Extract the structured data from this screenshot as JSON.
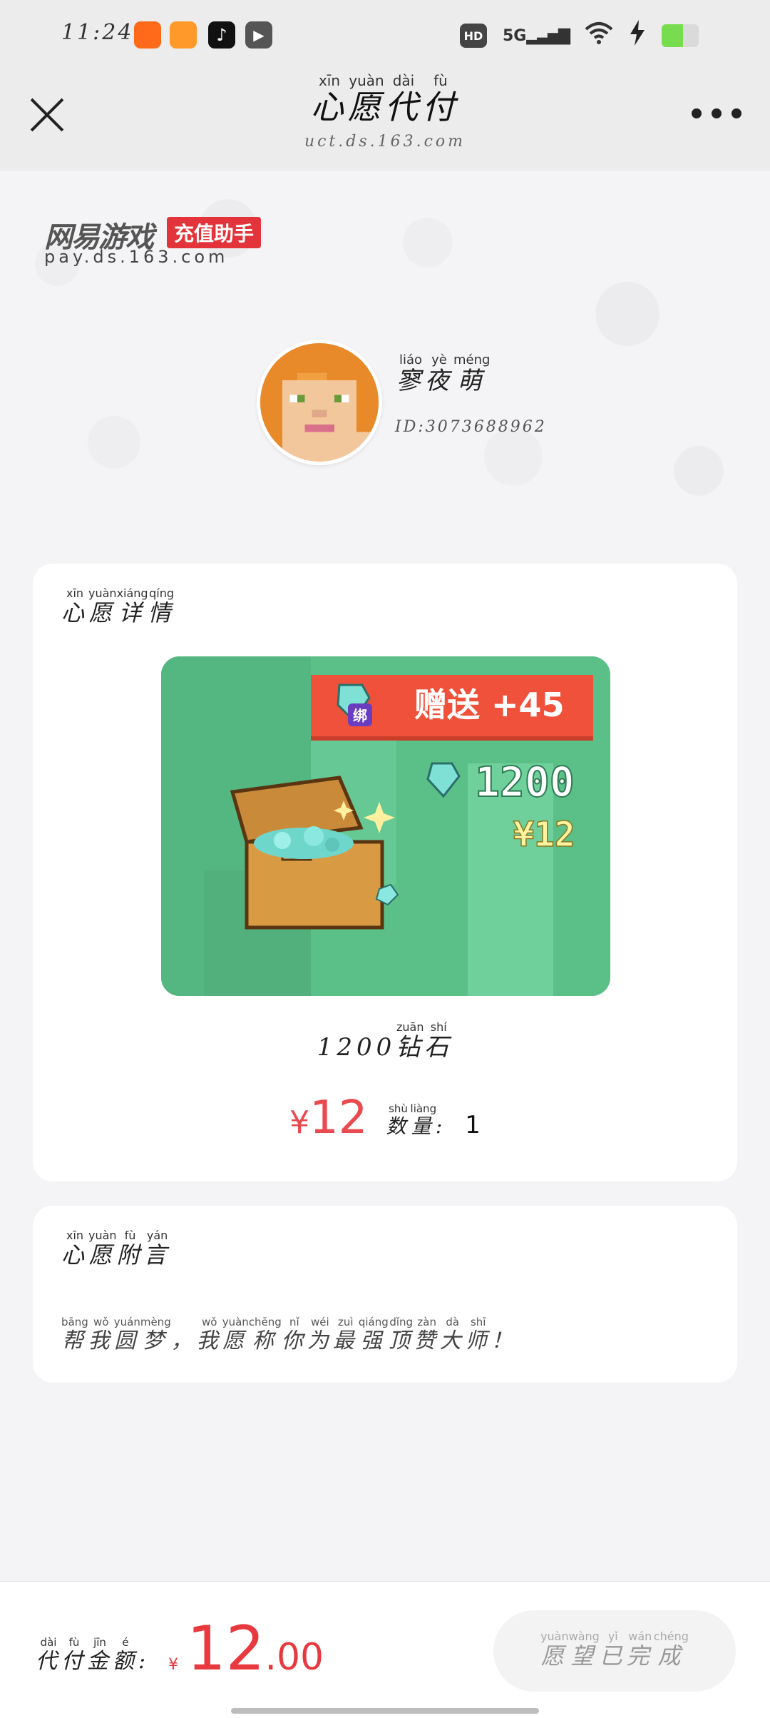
{
  "status_bar": {
    "time": "11:24",
    "network": "5G",
    "hd_label": "HD",
    "apps": [
      {
        "name": "kuaishou-app-icon",
        "color": "#ff6a1a"
      },
      {
        "name": "video-app-icon",
        "color": "#ff9a2a"
      },
      {
        "name": "tiktok-app-icon",
        "color": "#111111"
      },
      {
        "name": "player-app-icon",
        "color": "#555555"
      }
    ]
  },
  "header": {
    "title": [
      {
        "char": "心",
        "py": "xīn"
      },
      {
        "char": "愿",
        "py": "yuàn"
      },
      {
        "char": "代",
        "py": "dài"
      },
      {
        "char": "付",
        "py": "fù"
      }
    ],
    "url": "uct.ds.163.com"
  },
  "brand": {
    "name": "网易游戏",
    "tag": "充值助手",
    "domain": "pay.ds.163.com"
  },
  "user": {
    "name": [
      {
        "char": "寥",
        "py": "liáo"
      },
      {
        "char": "夜",
        "py": "yè"
      },
      {
        "char": "萌",
        "py": "méng"
      }
    ],
    "id": "ID:3073688962"
  },
  "wish_details": {
    "heading": [
      {
        "char": "心",
        "py": "xīn"
      },
      {
        "char": "愿",
        "py": "yuàn"
      },
      {
        "char": "详",
        "py": "xiáng"
      },
      {
        "char": "情",
        "py": "qíng"
      }
    ],
    "product_image": {
      "bonus_badge": "绑",
      "bonus_text": "赠送 +45",
      "amount": "1200",
      "price_tag": "¥12"
    },
    "product_prefix": "1200",
    "product_name": [
      {
        "char": "钻",
        "py": "zuān"
      },
      {
        "char": "石",
        "py": "shí"
      }
    ],
    "price_symbol": "¥",
    "price_value": "12",
    "qty_label": [
      {
        "char": "数",
        "py": "shù"
      },
      {
        "char": "量",
        "py": "liàng"
      }
    ],
    "qty_colon": ":",
    "qty_value": "1"
  },
  "wish_message": {
    "heading": [
      {
        "char": "心",
        "py": "xīn"
      },
      {
        "char": "愿",
        "py": "yuàn"
      },
      {
        "char": "附",
        "py": "fù"
      },
      {
        "char": "言",
        "py": "yán"
      }
    ],
    "text": [
      {
        "char": "帮",
        "py": "bāng"
      },
      {
        "char": "我",
        "py": "wǒ"
      },
      {
        "char": "圆",
        "py": "yuán"
      },
      {
        "char": "梦",
        "py": "mèng"
      },
      {
        "char": "，",
        "py": ""
      },
      {
        "char": "我",
        "py": "wǒ"
      },
      {
        "char": "愿",
        "py": "yuàn"
      },
      {
        "char": "称",
        "py": "chēng"
      },
      {
        "char": "你",
        "py": "nǐ"
      },
      {
        "char": "为",
        "py": "wéi"
      },
      {
        "char": "最",
        "py": "zuì"
      },
      {
        "char": "强",
        "py": "qiáng"
      },
      {
        "char": "顶",
        "py": "dǐng"
      },
      {
        "char": "赞",
        "py": "zàn"
      },
      {
        "char": "大",
        "py": "dà"
      },
      {
        "char": "师",
        "py": "shī"
      },
      {
        "char": "！",
        "py": ""
      }
    ]
  },
  "bottom_bar": {
    "label": [
      {
        "char": "代",
        "py": "dài"
      },
      {
        "char": "付",
        "py": "fù"
      },
      {
        "char": "金",
        "py": "jīn"
      },
      {
        "char": "额",
        "py": "é"
      }
    ],
    "colon": ":",
    "currency": "¥",
    "amount_int": "12",
    "amount_dec": ".00",
    "button": [
      {
        "char": "愿",
        "py": "yuàn"
      },
      {
        "char": "望",
        "py": "wàng"
      },
      {
        "char": "已",
        "py": "yǐ"
      },
      {
        "char": "完",
        "py": "wán"
      },
      {
        "char": "成",
        "py": "chéng"
      }
    ]
  },
  "colors": {
    "accent_red": "#e84a4f",
    "product_green": "#5bc088",
    "banner_orange": "#f0513a"
  }
}
